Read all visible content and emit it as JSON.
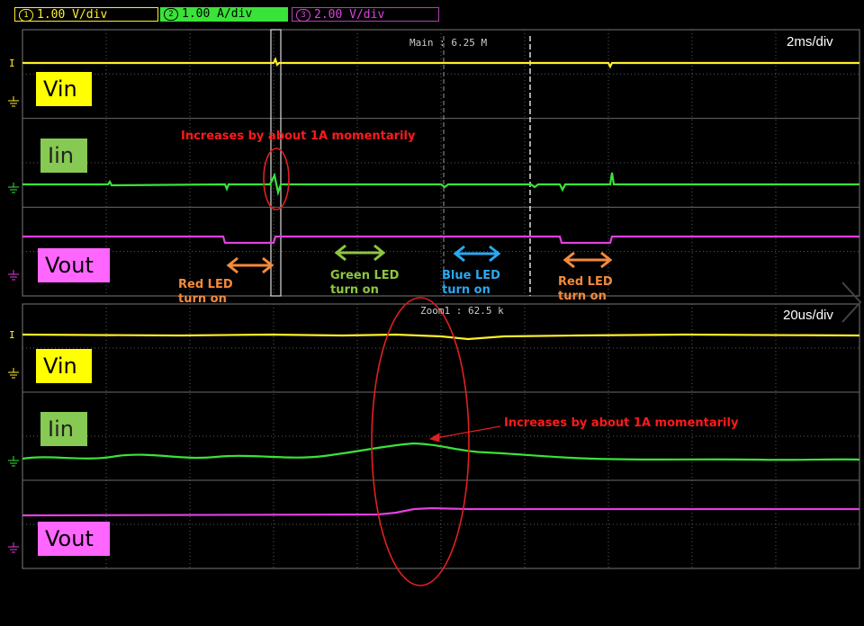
{
  "header": {
    "ch1": {
      "num": "1",
      "label": "1.00 V/div"
    },
    "ch2": {
      "num": "2",
      "label": "1.00 A/div"
    },
    "ch3": {
      "num": "3",
      "label": "2.00 V/div"
    }
  },
  "main_panel": {
    "sample_label": "Main : 6.25 M",
    "timebase": "2ms/div"
  },
  "zoom_panel": {
    "sample_label": "Zoom1 : 62.5 k",
    "timebase": "20us/div"
  },
  "channel_labels": {
    "vin": "Vin",
    "iin": "Iin",
    "vout": "Vout"
  },
  "annotations": {
    "spike_main": "Increases by about 1A momentarily",
    "spike_zoom": "Increases by about 1A momentarily",
    "red_led_1": [
      "Red LED",
      "turn on"
    ],
    "green_led": [
      "Green LED",
      "turn on"
    ],
    "blue_led": [
      "Blue LED",
      "turn on"
    ],
    "red_led_2": [
      "Red LED",
      "turn on"
    ]
  },
  "colors": {
    "ch1": "#ffef2a",
    "ch2": "#39e339",
    "ch3": "#e040e0",
    "annotation_red": "#ff1a1a",
    "red_led": "#f48a3c",
    "green_led": "#8ec63f",
    "blue_led": "#2aa8f2"
  }
}
